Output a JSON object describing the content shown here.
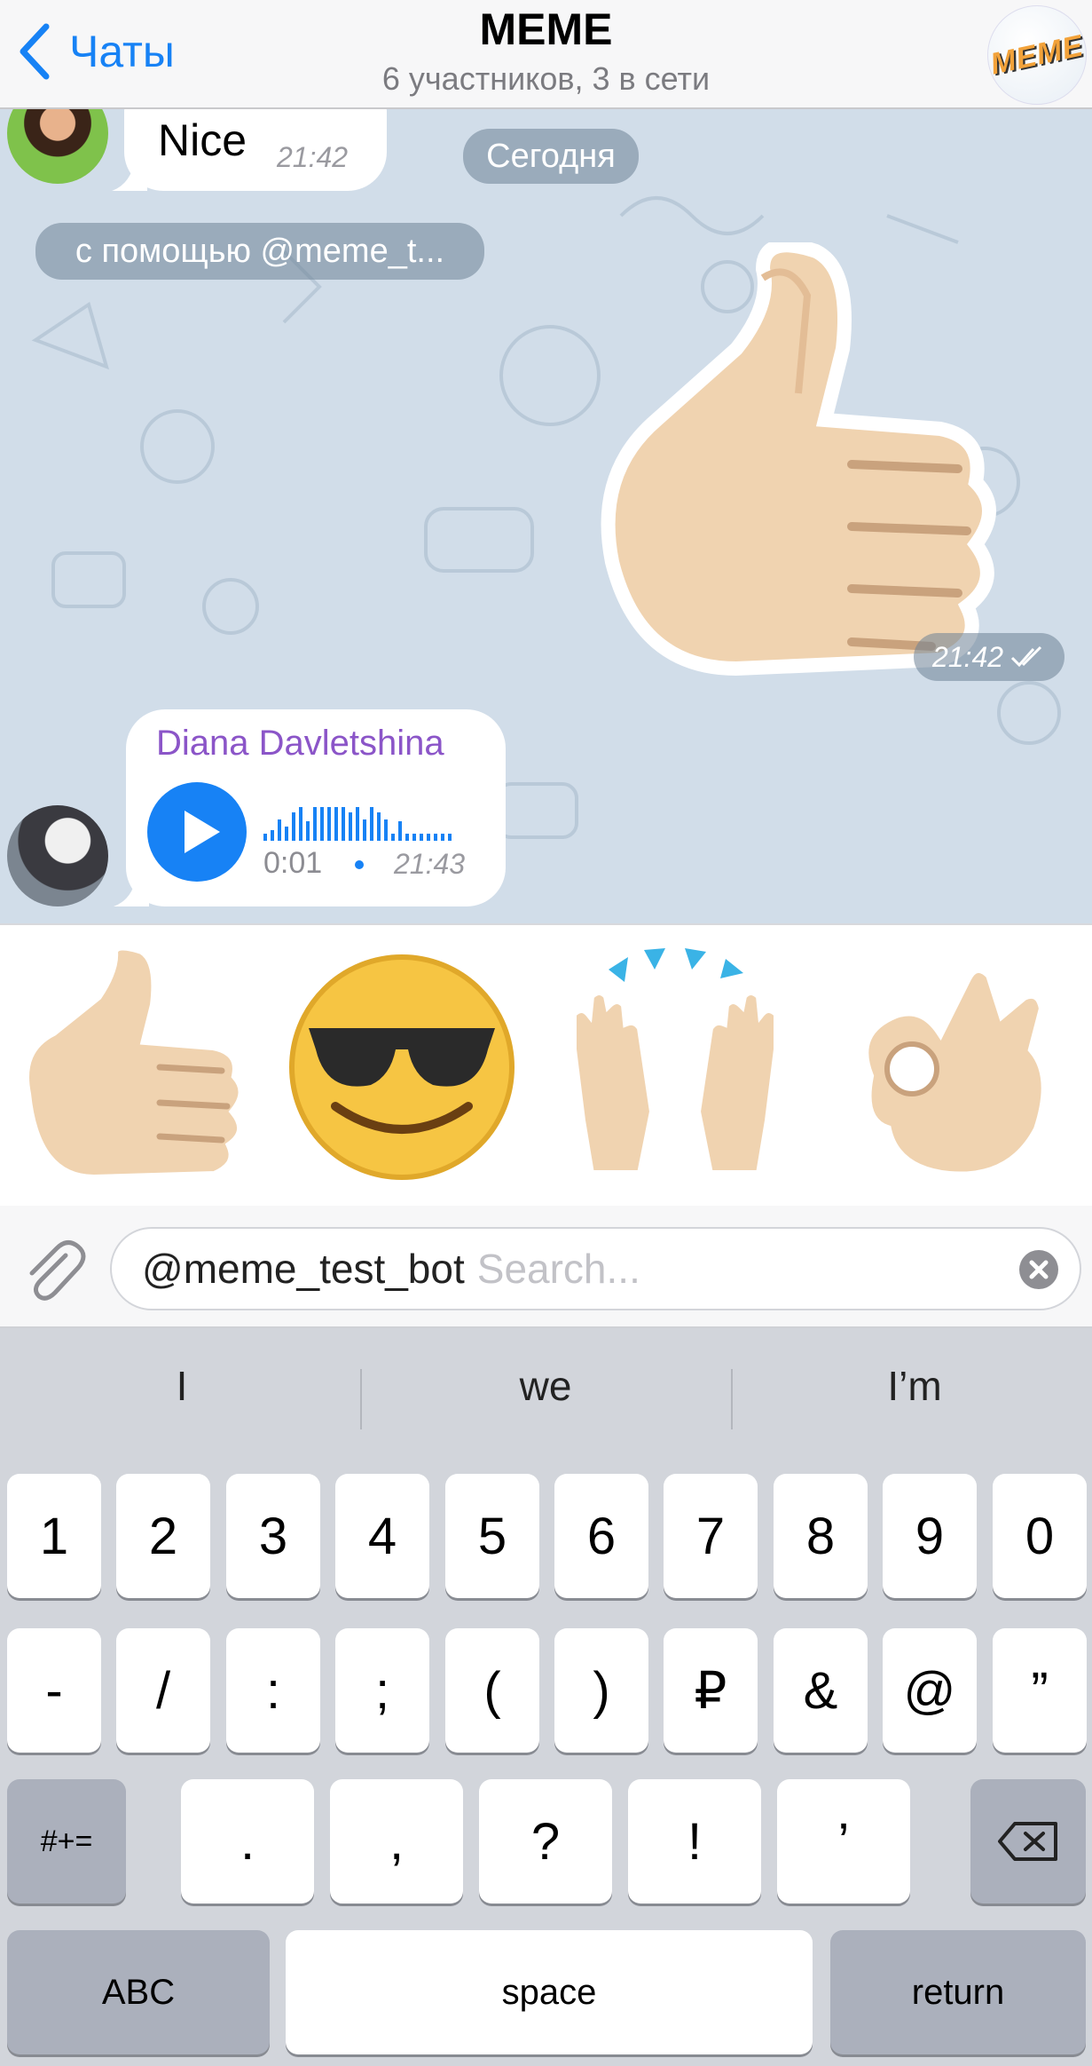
{
  "header": {
    "back_label": "Чаты",
    "title": "MEME",
    "subtitle": "6 участников, 3 в сети",
    "avatar_text": "MEME"
  },
  "chat": {
    "message1": {
      "text": "Nice",
      "time": "21:42"
    },
    "date_badge": "Сегодня",
    "via_bot": "с помощью @meme_t...",
    "sticker_time": "21:42",
    "voice": {
      "sender": "Diana Davletshina",
      "duration": "0:01",
      "time": "21:43",
      "sender_color": "#8b55c8"
    }
  },
  "stickers": [
    {
      "icon": "thumbs-up-sticker"
    },
    {
      "icon": "sunglasses-face-sticker"
    },
    {
      "icon": "raised-hands-sticker"
    },
    {
      "icon": "ok-hand-sticker"
    }
  ],
  "input": {
    "value": "@meme_test_bot",
    "placeholder": "Search..."
  },
  "keyboard": {
    "suggestions": [
      "I",
      "we",
      "I’m"
    ],
    "row1": [
      "1",
      "2",
      "3",
      "4",
      "5",
      "6",
      "7",
      "8",
      "9",
      "0"
    ],
    "row2": [
      "-",
      "/",
      ":",
      ";",
      "(",
      ")",
      "₽",
      "&",
      "@",
      "”"
    ],
    "row3": [
      ".",
      ",",
      "?",
      "!",
      "’"
    ],
    "symbols_key": "#+=",
    "abc_key": "ABC",
    "space_key": "space",
    "return_key": "return"
  },
  "colors": {
    "accent": "#1782f5",
    "chat_background": "#d1dde9",
    "keyboard_background": "#d2d5db"
  }
}
